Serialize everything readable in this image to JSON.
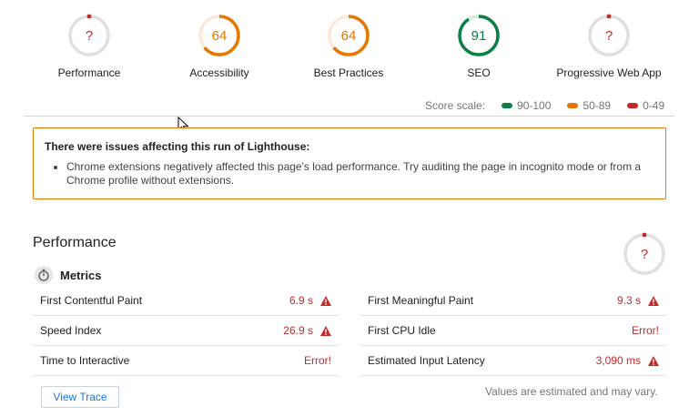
{
  "gauges": [
    {
      "label": "Performance",
      "score": "?",
      "color": "#c62828",
      "type": "error"
    },
    {
      "label": "Accessibility",
      "score": "64",
      "color": "#e67700",
      "type": "average",
      "fraction": 0.64
    },
    {
      "label": "Best Practices",
      "score": "64",
      "color": "#e67700",
      "type": "average",
      "fraction": 0.64
    },
    {
      "label": "SEO",
      "score": "91",
      "color": "#0b8043",
      "type": "pass",
      "fraction": 0.91
    },
    {
      "label": "Progressive Web App",
      "score": "?",
      "color": "#c62828",
      "type": "error"
    }
  ],
  "scale": {
    "label": "Score scale:",
    "pass": {
      "text": "90-100",
      "color": "#0b8043"
    },
    "average": {
      "text": "50-89",
      "color": "#e67700"
    },
    "fail": {
      "text": "0-49",
      "color": "#c62828"
    }
  },
  "warning": {
    "title": "There were issues affecting this run of Lighthouse:",
    "items": [
      "Chrome extensions negatively affected this page's load performance. Try auditing the page in incognito mode or from a Chrome profile without extensions."
    ]
  },
  "performance": {
    "title": "Performance",
    "score": "?",
    "metrics_label": "Metrics",
    "left": [
      {
        "label": "First Contentful Paint",
        "value": "6.9 s",
        "warn": true
      },
      {
        "label": "Speed Index",
        "value": "26.9 s",
        "warn": true
      },
      {
        "label": "Time to Interactive",
        "value": "Error!",
        "warn": false
      }
    ],
    "right": [
      {
        "label": "First Meaningful Paint",
        "value": "9.3 s",
        "warn": true
      },
      {
        "label": "First CPU Idle",
        "value": "Error!",
        "warn": false
      },
      {
        "label": "Estimated Input Latency",
        "value": "3,090 ms",
        "warn": true
      }
    ],
    "view_trace": "View Trace",
    "note": "Values are estimated and may vary."
  }
}
